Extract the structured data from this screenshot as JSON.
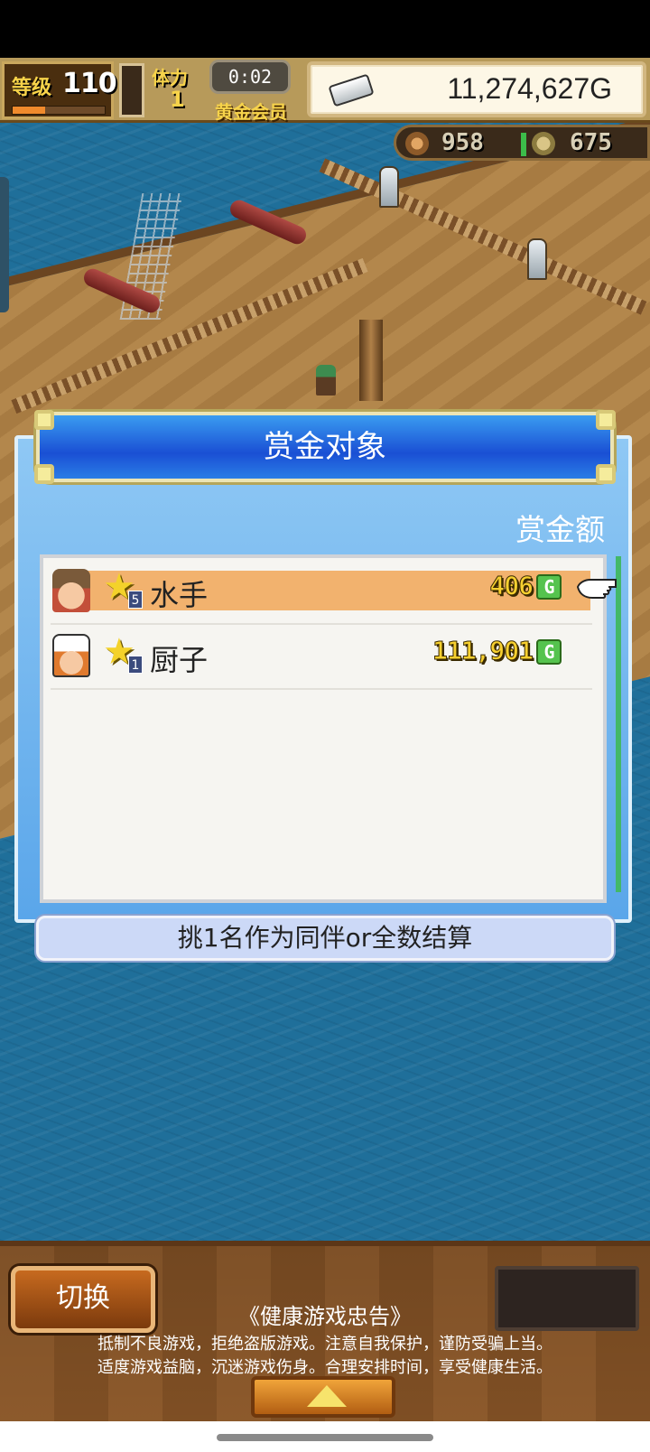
{
  "hud": {
    "level_label": "等级",
    "level_value": "110",
    "exp_progress": 0.35,
    "stamina_label": "体力",
    "stamina_value": "1",
    "timer": "0:02",
    "member_label": "黄金会员",
    "gold": "11,274,627G",
    "wood": "958",
    "medals": "675",
    "icons": [
      "ingot-icon",
      "wood-icon",
      "medal-coin-icon"
    ]
  },
  "modal": {
    "title": "赏金对象",
    "column_header": "赏金额",
    "rows": [
      {
        "avatar": "sailor-avatar",
        "rank": "5",
        "name": "水手",
        "amount": "406",
        "currency": "G",
        "selected": true
      },
      {
        "avatar": "cook-avatar",
        "rank": "1",
        "name": "厨子",
        "amount": "111,901",
        "currency": "G",
        "selected": false
      }
    ],
    "hint": "挑1名作为同伴or全数结算"
  },
  "bottom": {
    "switch_label": "切换",
    "notice_title": "《健康游戏忠告》",
    "notice_line1": "抵制不良游戏，拒绝盗版游戏。注意自我保护，谨防受骗上当。",
    "notice_line2": "适度游戏益脑，沉迷游戏伤身。合理安排时间，享受健康生活。"
  },
  "colors": {
    "accent_blue": "#1a4fd4",
    "selected_row": "#f2b26e",
    "gold_text": "#f7d030",
    "currency_badge": "#55c34e"
  }
}
